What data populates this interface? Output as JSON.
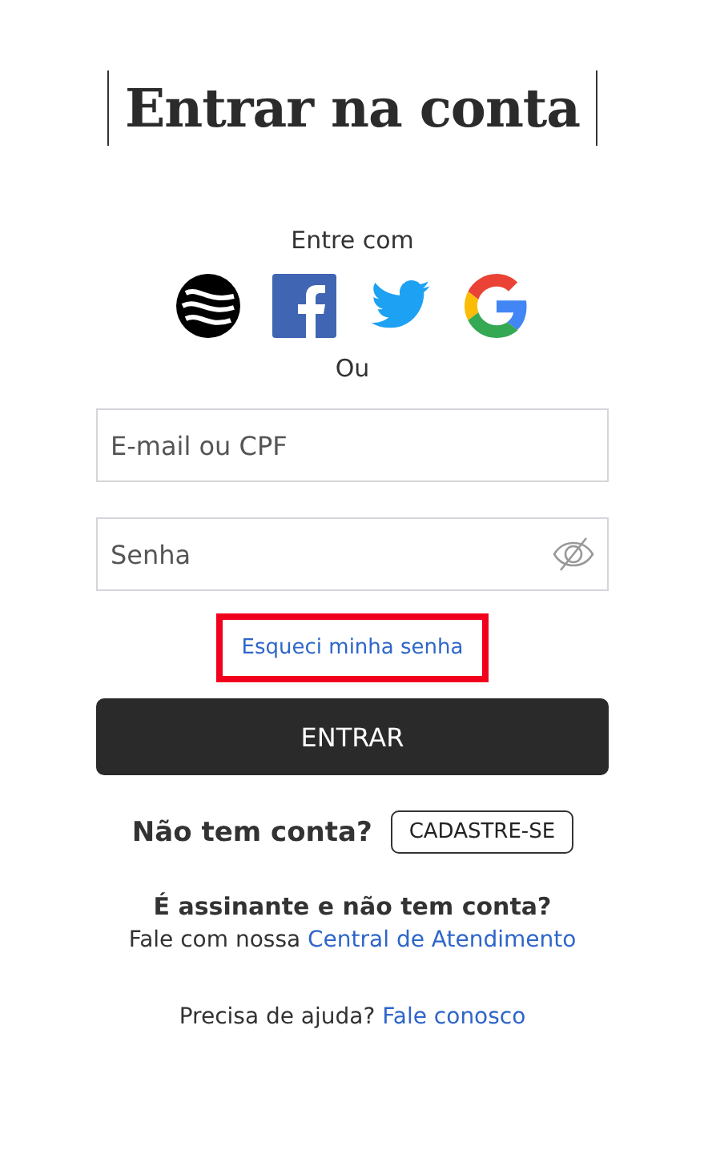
{
  "title": "Entrar na conta",
  "social": {
    "label": "Entre com",
    "providers": [
      {
        "kind": "wave"
      },
      {
        "kind": "facebook"
      },
      {
        "kind": "twitter"
      },
      {
        "kind": "google"
      }
    ]
  },
  "divider": "Ou",
  "fields": [
    {
      "placeholder": "E-mail ou CPF",
      "kind": "text"
    },
    {
      "placeholder": "Senha",
      "kind": "password"
    }
  ],
  "forgot": {
    "label": "Esqueci minha senha",
    "focused": true
  },
  "submit": "ENTRAR",
  "signup": {
    "question": "Não tem conta?",
    "button": "CADASTRE-SE"
  },
  "subscriber": {
    "question": "É assinante e não tem conta?",
    "text": "Fale com nossa",
    "link": "Central de Atendimento"
  },
  "help": {
    "text": "Precisa de ajuda?",
    "link": "Fale conosco"
  }
}
